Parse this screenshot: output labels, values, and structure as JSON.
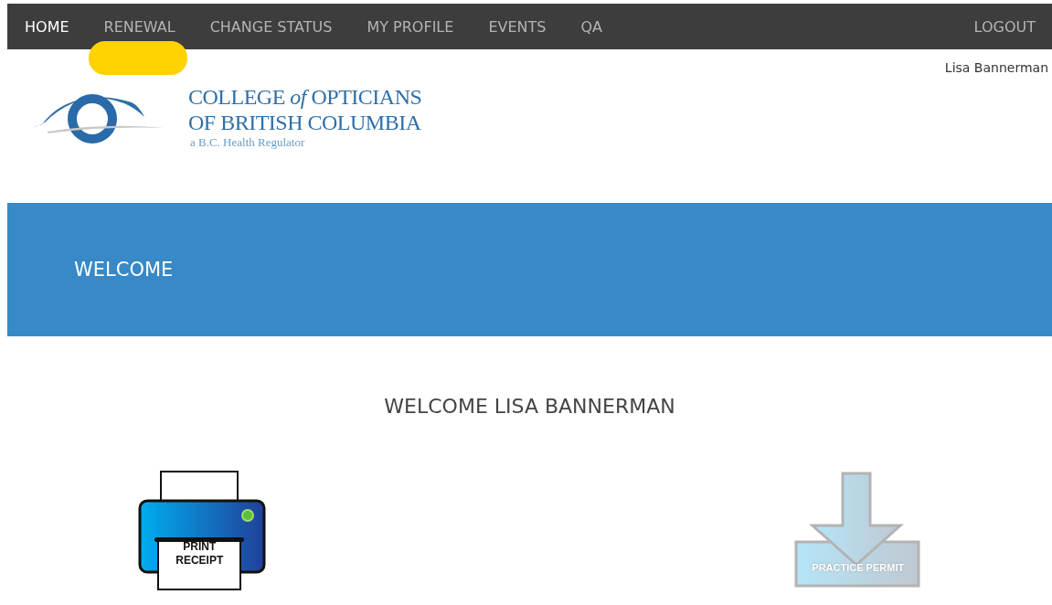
{
  "nav": {
    "items": [
      {
        "label": "HOME",
        "selected": true,
        "highlighted": false
      },
      {
        "label": "RENEWAL",
        "selected": false,
        "highlighted": true
      },
      {
        "label": "CHANGE STATUS",
        "selected": false,
        "highlighted": false
      },
      {
        "label": "MY PROFILE",
        "selected": false,
        "highlighted": false
      },
      {
        "label": "EVENTS",
        "selected": false,
        "highlighted": false
      },
      {
        "label": "QA",
        "selected": false,
        "highlighted": false
      }
    ],
    "logout": "LOGOUT"
  },
  "user_name": "Lisa Bannerman",
  "logo": {
    "line1": "COLLEGE *of* OPTICIANS",
    "line2": "OF BRITISH COLUMBIA",
    "tagline": "a B.C. Health Regulator"
  },
  "banner": {
    "title": "WELCOME"
  },
  "greeting": "WELCOME LISA BANNERMAN",
  "actions": [
    {
      "kind": "printer",
      "label": "PRINT RECEIPT"
    },
    {
      "kind": "download",
      "label": "PRACTICE PERMIT"
    }
  ]
}
